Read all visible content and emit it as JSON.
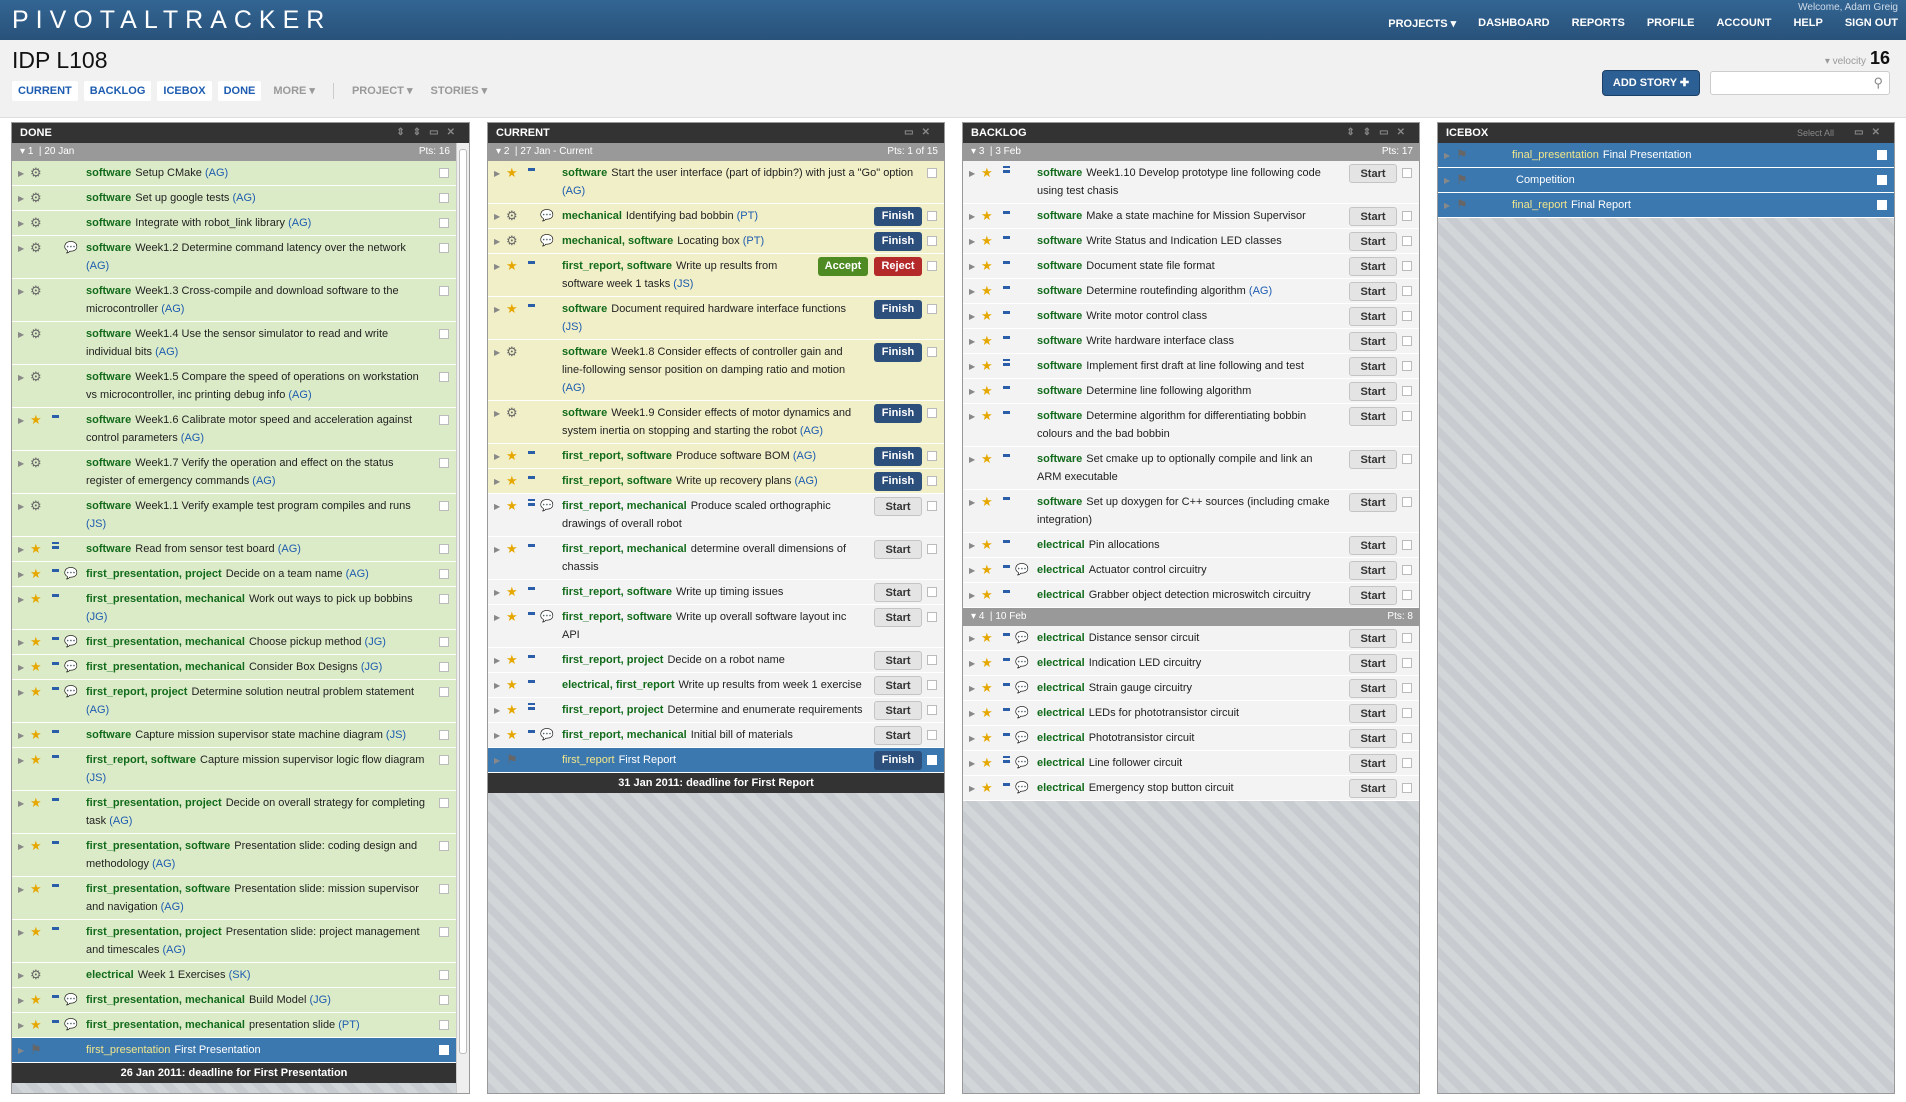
{
  "app": {
    "logo": "PIVOTALTRACKER",
    "welcome": "Welcome, Adam Greig",
    "nav": [
      "PROJECTS ▾",
      "DASHBOARD",
      "REPORTS",
      "PROFILE",
      "ACCOUNT",
      "HELP",
      "SIGN OUT"
    ]
  },
  "project": {
    "title": "IDP L108",
    "tabs": [
      "CURRENT",
      "BACKLOG",
      "ICEBOX",
      "DONE"
    ],
    "more_tabs": [
      "MORE ▾",
      "PROJECT ▾",
      "STORIES ▾"
    ],
    "velocity_label": "▾ velocity",
    "velocity": "16",
    "add_story": "ADD STORY ✚",
    "search_placeholder": ""
  },
  "done": {
    "title": "DONE",
    "iteration": {
      "num": "1",
      "date": "20 Jan",
      "pts": "Pts: 16"
    },
    "stories": [
      {
        "icon": "gear",
        "labels": "software",
        "text": "Setup CMake",
        "owner": "(AG)"
      },
      {
        "icon": "gear",
        "labels": "software",
        "text": "Set up google tests",
        "owner": "(AG)"
      },
      {
        "icon": "gear",
        "labels": "software",
        "text": "Integrate with robot_link library",
        "owner": "(AG)"
      },
      {
        "icon": "gear",
        "cmt": true,
        "labels": "software",
        "text": "Week1.2 Determine command latency over the network",
        "owner": "(AG)"
      },
      {
        "icon": "gear",
        "labels": "software",
        "text": "Week1.3 Cross-compile and download software to the microcontroller",
        "owner": "(AG)"
      },
      {
        "icon": "gear",
        "labels": "software",
        "text": "Week1.4 Use the sensor simulator to read and write individual bits",
        "owner": "(AG)"
      },
      {
        "icon": "gear",
        "labels": "software",
        "text": "Week1.5 Compare the speed of operations on workstation vs microcontroller, inc printing debug info",
        "owner": "(AG)"
      },
      {
        "icon": "star",
        "est": 1,
        "labels": "software",
        "text": "Week1.6 Calibrate motor speed and acceleration against control parameters",
        "owner": "(AG)"
      },
      {
        "icon": "gear",
        "labels": "software",
        "text": "Week1.7 Verify the operation and effect on the status register of emergency commands",
        "owner": "(AG)"
      },
      {
        "icon": "gear",
        "labels": "software",
        "text": "Week1.1 Verify example test program compiles and runs",
        "owner": "(JS)"
      },
      {
        "icon": "star",
        "est": 2,
        "labels": "software",
        "text": "Read from sensor test board",
        "owner": "(AG)"
      },
      {
        "icon": "star",
        "est": 1,
        "cmt": true,
        "labels": "first_presentation, project",
        "text": "Decide on a team name",
        "owner": "(AG)"
      },
      {
        "icon": "star",
        "est": 1,
        "labels": "first_presentation, mechanical",
        "text": "Work out ways to pick up bobbins",
        "owner": "(JG)"
      },
      {
        "icon": "star",
        "est": 1,
        "cmt": true,
        "labels": "first_presentation, mechanical",
        "text": "Choose pickup method",
        "owner": "(JG)"
      },
      {
        "icon": "star",
        "est": 1,
        "cmt": true,
        "labels": "first_presentation, mechanical",
        "text": "Consider Box Designs",
        "owner": "(JG)"
      },
      {
        "icon": "star",
        "est": 1,
        "cmt": true,
        "labels": "first_report, project",
        "text": "Determine solution neutral problem statement",
        "owner": "(AG)"
      },
      {
        "icon": "star",
        "est": 1,
        "labels": "software",
        "text": "Capture mission supervisor state machine diagram",
        "owner": "(JS)"
      },
      {
        "icon": "star",
        "est": 1,
        "labels": "first_report, software",
        "text": "Capture mission supervisor logic flow diagram",
        "owner": "(JS)"
      },
      {
        "icon": "star",
        "est": 1,
        "labels": "first_presentation, project",
        "text": "Decide on overall strategy for completing task",
        "owner": "(AG)"
      },
      {
        "icon": "star",
        "est": 1,
        "labels": "first_presentation, software",
        "text": "Presentation slide: coding design and methodology",
        "owner": "(AG)"
      },
      {
        "icon": "star",
        "est": 1,
        "labels": "first_presentation, software",
        "text": "Presentation slide: mission supervisor and navigation",
        "owner": "(AG)"
      },
      {
        "icon": "star",
        "est": 1,
        "labels": "first_presentation, project",
        "text": "Presentation slide: project management and timescales",
        "owner": "(AG)"
      },
      {
        "icon": "gear",
        "labels": "electrical",
        "text": "Week 1 Exercises",
        "owner": "(SK)"
      },
      {
        "icon": "star",
        "est": 1,
        "cmt": true,
        "labels": "first_presentation, mechanical",
        "text": "Build Model",
        "owner": "(JG)"
      },
      {
        "icon": "star",
        "est": 1,
        "cmt": true,
        "labels": "first_presentation, mechanical",
        "text": "presentation slide",
        "owner": "(PT)"
      },
      {
        "icon": "flag",
        "release": true,
        "labels": "first_presentation",
        "text": "First Presentation",
        "owner": ""
      }
    ],
    "deadline": "26 Jan 2011: deadline for First Presentation"
  },
  "current": {
    "title": "CURRENT",
    "iteration": {
      "num": "2",
      "date": "27 Jan - Current",
      "pts": "Pts: 1 of 15"
    },
    "stories": [
      {
        "icon": "star",
        "est": 1,
        "labels": "software",
        "text": "Start the user interface (part of idpbin?) with just a \"Go\" option",
        "owner": "(AG)"
      },
      {
        "icon": "gear",
        "cmt": true,
        "labels": "mechanical",
        "text": "Identifying bad bobbin",
        "owner": "(PT)",
        "btn": "Finish"
      },
      {
        "icon": "gear",
        "cmt": true,
        "labels": "mechanical, software",
        "text": "Locating box",
        "owner": "(PT)",
        "btn": "Finish"
      },
      {
        "icon": "star",
        "est": 1,
        "labels": "first_report, software",
        "text": "Write up results from software week 1 tasks",
        "owner": "(JS)",
        "accept": "Accept",
        "reject": "Reject"
      },
      {
        "icon": "star",
        "est": 1,
        "labels": "software",
        "text": "Document required hardware interface functions",
        "owner": "(JS)",
        "btn": "Finish"
      },
      {
        "icon": "gear",
        "labels": "software",
        "text": "Week1.8 Consider effects of controller gain and line-following sensor position on damping ratio and motion",
        "owner": "(AG)",
        "btn": "Finish"
      },
      {
        "icon": "gear",
        "labels": "software",
        "text": "Week1.9 Consider effects of motor dynamics and system inertia on stopping and starting the robot",
        "owner": "(AG)",
        "btn": "Finish"
      },
      {
        "icon": "star",
        "est": 1,
        "labels": "first_report, software",
        "text": "Produce software BOM",
        "owner": "(AG)",
        "btn": "Finish"
      },
      {
        "icon": "star",
        "est": 1,
        "labels": "first_report, software",
        "text": "Write up recovery plans",
        "owner": "(AG)",
        "btn": "Finish"
      },
      {
        "icon": "star",
        "est": 2,
        "cmt": true,
        "labels": "first_report, mechanical",
        "text": "Produce scaled orthographic drawings of overall robot",
        "owner": "",
        "btn": "Start",
        "unstarted": true
      },
      {
        "icon": "star",
        "est": 1,
        "labels": "first_report, mechanical",
        "text": "determine overall dimensions of chassis",
        "owner": "",
        "btn": "Start",
        "unstarted": true
      },
      {
        "icon": "star",
        "est": 1,
        "labels": "first_report, software",
        "text": "Write up timing issues",
        "owner": "",
        "btn": "Start",
        "unstarted": true
      },
      {
        "icon": "star",
        "est": 1,
        "cmt": true,
        "labels": "first_report, software",
        "text": "Write up overall software layout inc API",
        "owner": "",
        "btn": "Start",
        "unstarted": true
      },
      {
        "icon": "star",
        "est": 1,
        "labels": "first_report, project",
        "text": "Decide on a robot name",
        "owner": "",
        "btn": "Start",
        "unstarted": true
      },
      {
        "icon": "star",
        "est": 1,
        "labels": "electrical, first_report",
        "text": "Write up results from week 1 exercise",
        "owner": "",
        "btn": "Start",
        "unstarted": true
      },
      {
        "icon": "star",
        "est": 2,
        "labels": "first_report, project",
        "text": "Determine and enumerate requirements",
        "owner": "",
        "btn": "Start",
        "unstarted": true
      },
      {
        "icon": "star",
        "est": 1,
        "cmt": true,
        "labels": "first_report, mechanical",
        "text": "Initial bill of materials",
        "owner": "",
        "btn": "Start",
        "unstarted": true
      },
      {
        "icon": "flag",
        "release": true,
        "labels": "first_report",
        "text": "First Report",
        "owner": "",
        "btn": "Finish"
      }
    ],
    "deadline": "31 Jan 2011: deadline for First Report"
  },
  "backlog": {
    "title": "BACKLOG",
    "iter3": {
      "num": "3",
      "date": "3 Feb",
      "pts": "Pts: 17"
    },
    "stories3": [
      {
        "icon": "star",
        "est": 2,
        "labels": "software",
        "text": "Week1.10 Develop prototype line following code using test chasis",
        "owner": "",
        "btn": "Start"
      },
      {
        "icon": "star",
        "est": 1,
        "labels": "software",
        "text": "Make a state machine for Mission Supervisor",
        "owner": "",
        "btn": "Start"
      },
      {
        "icon": "star",
        "est": 1,
        "labels": "software",
        "text": "Write Status and Indication LED classes",
        "owner": "",
        "btn": "Start"
      },
      {
        "icon": "star",
        "est": 1,
        "labels": "software",
        "text": "Document state file format",
        "owner": "",
        "btn": "Start"
      },
      {
        "icon": "star",
        "est": 1,
        "labels": "software",
        "text": "Determine routefinding algorithm",
        "owner": "(AG)",
        "btn": "Start"
      },
      {
        "icon": "star",
        "est": 1,
        "labels": "software",
        "text": "Write motor control class",
        "owner": "",
        "btn": "Start"
      },
      {
        "icon": "star",
        "est": 1,
        "labels": "software",
        "text": "Write hardware interface class",
        "owner": "",
        "btn": "Start"
      },
      {
        "icon": "star",
        "est": 2,
        "labels": "software",
        "text": "Implement first draft at line following and test",
        "owner": "",
        "btn": "Start"
      },
      {
        "icon": "star",
        "est": 1,
        "labels": "software",
        "text": "Determine line following algorithm",
        "owner": "",
        "btn": "Start"
      },
      {
        "icon": "star",
        "est": 1,
        "labels": "software",
        "text": "Determine algorithm for differentiating bobbin colours and the bad bobbin",
        "owner": "",
        "btn": "Start"
      },
      {
        "icon": "star",
        "est": 1,
        "labels": "software",
        "text": "Set cmake up to optionally compile and link an ARM executable",
        "owner": "",
        "btn": "Start"
      },
      {
        "icon": "star",
        "est": 1,
        "labels": "software",
        "text": "Set up doxygen for C++ sources (including cmake integration)",
        "owner": "",
        "btn": "Start"
      },
      {
        "icon": "star",
        "est": 1,
        "labels": "electrical",
        "text": "Pin allocations",
        "owner": "",
        "btn": "Start"
      },
      {
        "icon": "star",
        "est": 1,
        "cmt": true,
        "labels": "electrical",
        "text": "Actuator control circuitry",
        "owner": "",
        "btn": "Start"
      },
      {
        "icon": "star",
        "est": 1,
        "labels": "electrical",
        "text": "Grabber object detection microswitch circuitry",
        "owner": "",
        "btn": "Start"
      }
    ],
    "iter4": {
      "num": "4",
      "date": "10 Feb",
      "pts": "Pts: 8"
    },
    "stories4": [
      {
        "icon": "star",
        "est": 1,
        "cmt": true,
        "labels": "electrical",
        "text": "Distance sensor circuit",
        "owner": "",
        "btn": "Start"
      },
      {
        "icon": "star",
        "est": 1,
        "cmt": true,
        "labels": "electrical",
        "text": "Indication LED circuitry",
        "owner": "",
        "btn": "Start"
      },
      {
        "icon": "star",
        "est": 1,
        "cmt": true,
        "labels": "electrical",
        "text": "Strain gauge circuitry",
        "owner": "",
        "btn": "Start"
      },
      {
        "icon": "star",
        "est": 1,
        "cmt": true,
        "labels": "electrical",
        "text": "LEDs for phototransistor circuit",
        "owner": "",
        "btn": "Start"
      },
      {
        "icon": "star",
        "est": 1,
        "cmt": true,
        "labels": "electrical",
        "text": "Phototransistor circuit",
        "owner": "",
        "btn": "Start"
      },
      {
        "icon": "star",
        "est": 2,
        "cmt": true,
        "labels": "electrical",
        "text": "Line follower circuit",
        "owner": "",
        "btn": "Start"
      },
      {
        "icon": "star",
        "est": 1,
        "cmt": true,
        "labels": "electrical",
        "text": "Emergency stop button circuit",
        "owner": "",
        "btn": "Start"
      }
    ]
  },
  "icebox": {
    "title": "ICEBOX",
    "select_all": "Select All",
    "stories": [
      {
        "icon": "flag",
        "release": true,
        "labels": "final_presentation",
        "text": "Final Presentation",
        "owner": ""
      },
      {
        "icon": "flag",
        "release": true,
        "labels": "",
        "text": "Competition",
        "owner": ""
      },
      {
        "icon": "flag",
        "release": true,
        "labels": "final_report",
        "text": "Final Report",
        "owner": ""
      }
    ]
  }
}
